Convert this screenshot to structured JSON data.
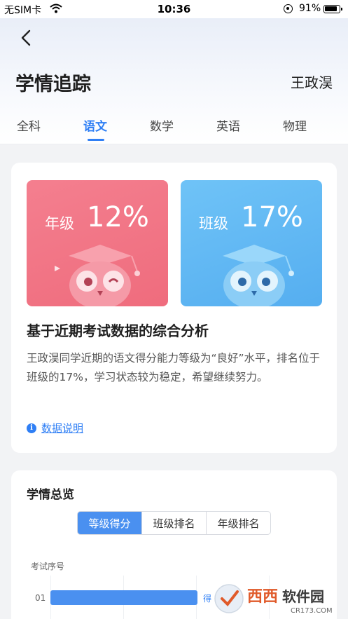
{
  "status_bar": {
    "carrier": "无SIM卡",
    "time": "10:36",
    "battery": "91%"
  },
  "header": {
    "title": "学情追踪",
    "student_name": "王政淏"
  },
  "tabs": [
    {
      "label": "全科",
      "active": false
    },
    {
      "label": "语文",
      "active": true
    },
    {
      "label": "数学",
      "active": false
    },
    {
      "label": "英语",
      "active": false
    },
    {
      "label": "物理",
      "active": false
    }
  ],
  "rank_cards": {
    "grade": {
      "label": "年级",
      "value": "12%",
      "color": "#ef6c7d"
    },
    "class": {
      "label": "班级",
      "value": "17%",
      "color": "#55aef0"
    }
  },
  "analysis": {
    "title": "基于近期考试数据的综合分析",
    "text": "王政淏同学近期的语文得分能力等级为“良好”水平，排名位于班级的17%，学习状态较为稳定，希望继续努力。",
    "data_note": "数据说明"
  },
  "overview": {
    "title": "学情总览",
    "segments": [
      {
        "label": "等级得分",
        "active": true
      },
      {
        "label": "班级排名",
        "active": false
      },
      {
        "label": "年级排名",
        "active": false
      }
    ],
    "axis_label": "考试序号",
    "rows": [
      {
        "label": "01",
        "value_text": "得"
      }
    ]
  },
  "watermark": {
    "text": "西西软件园",
    "sub": "CR173.COM"
  },
  "colors": {
    "accent": "#2f7ff5",
    "bar": "#4a90f0"
  }
}
